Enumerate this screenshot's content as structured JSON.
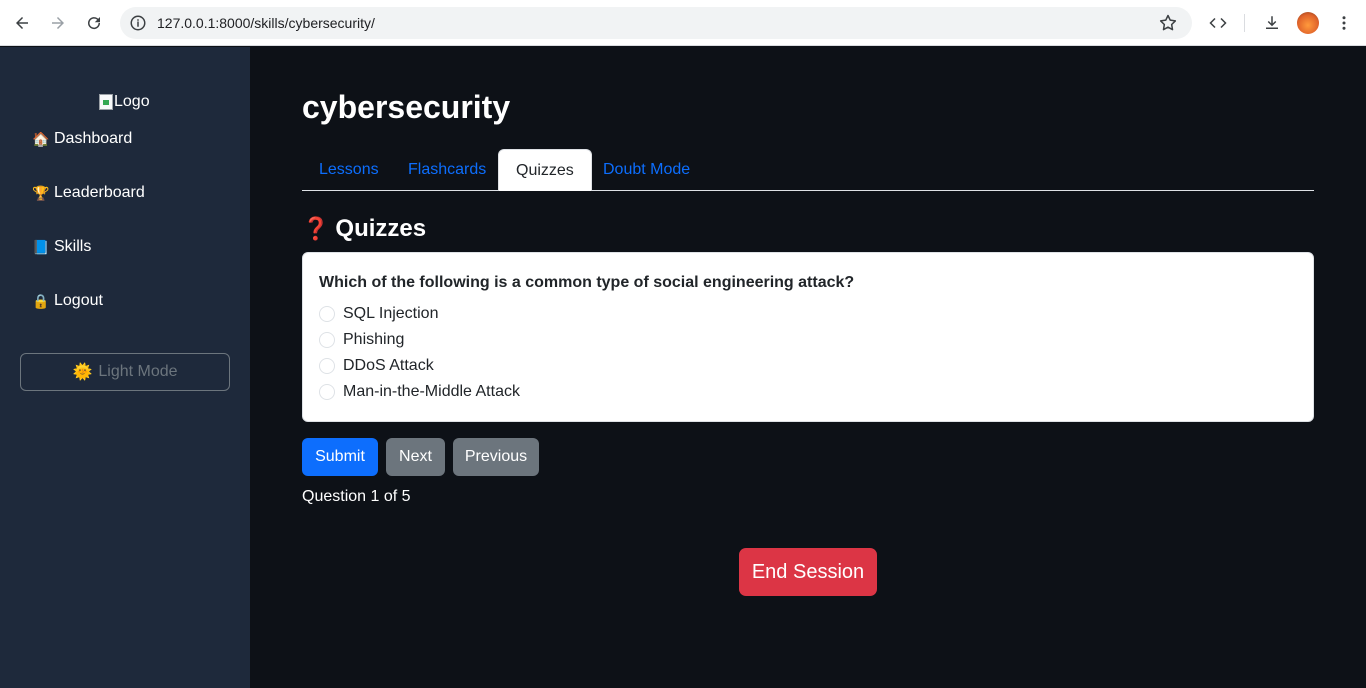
{
  "browser": {
    "url": "127.0.0.1:8000/skills/cybersecurity/"
  },
  "sidebar": {
    "logo_alt": "Logo",
    "items": [
      {
        "icon": "🏠",
        "label": "Dashboard"
      },
      {
        "icon": "🏆",
        "label": "Leaderboard"
      },
      {
        "icon": "📘",
        "label": "Skills"
      },
      {
        "icon": "🔒",
        "label": "Logout"
      }
    ],
    "mode_toggle": {
      "icon": "🌞",
      "label": "Light Mode"
    }
  },
  "main": {
    "title": "cybersecurity",
    "tabs": [
      {
        "label": "Lessons",
        "active": false
      },
      {
        "label": "Flashcards",
        "active": false
      },
      {
        "label": "Quizzes",
        "active": true
      },
      {
        "label": "Doubt Mode",
        "active": false
      }
    ],
    "section": {
      "icon": "❓",
      "title": "Quizzes"
    },
    "quiz": {
      "question": "Which of the following is a common type of social engineering attack?",
      "options": [
        "SQL Injection",
        "Phishing",
        "DDoS Attack",
        "Man-in-the-Middle Attack"
      ]
    },
    "buttons": {
      "submit": "Submit",
      "next": "Next",
      "previous": "Previous"
    },
    "progress": "Question 1 of 5",
    "end_session": "End Session"
  },
  "colors": {
    "primary": "#0d6efd",
    "secondary": "#6c757d",
    "danger": "#dc3545",
    "sidebar_bg": "#1e293b",
    "main_bg": "#0d1117"
  }
}
